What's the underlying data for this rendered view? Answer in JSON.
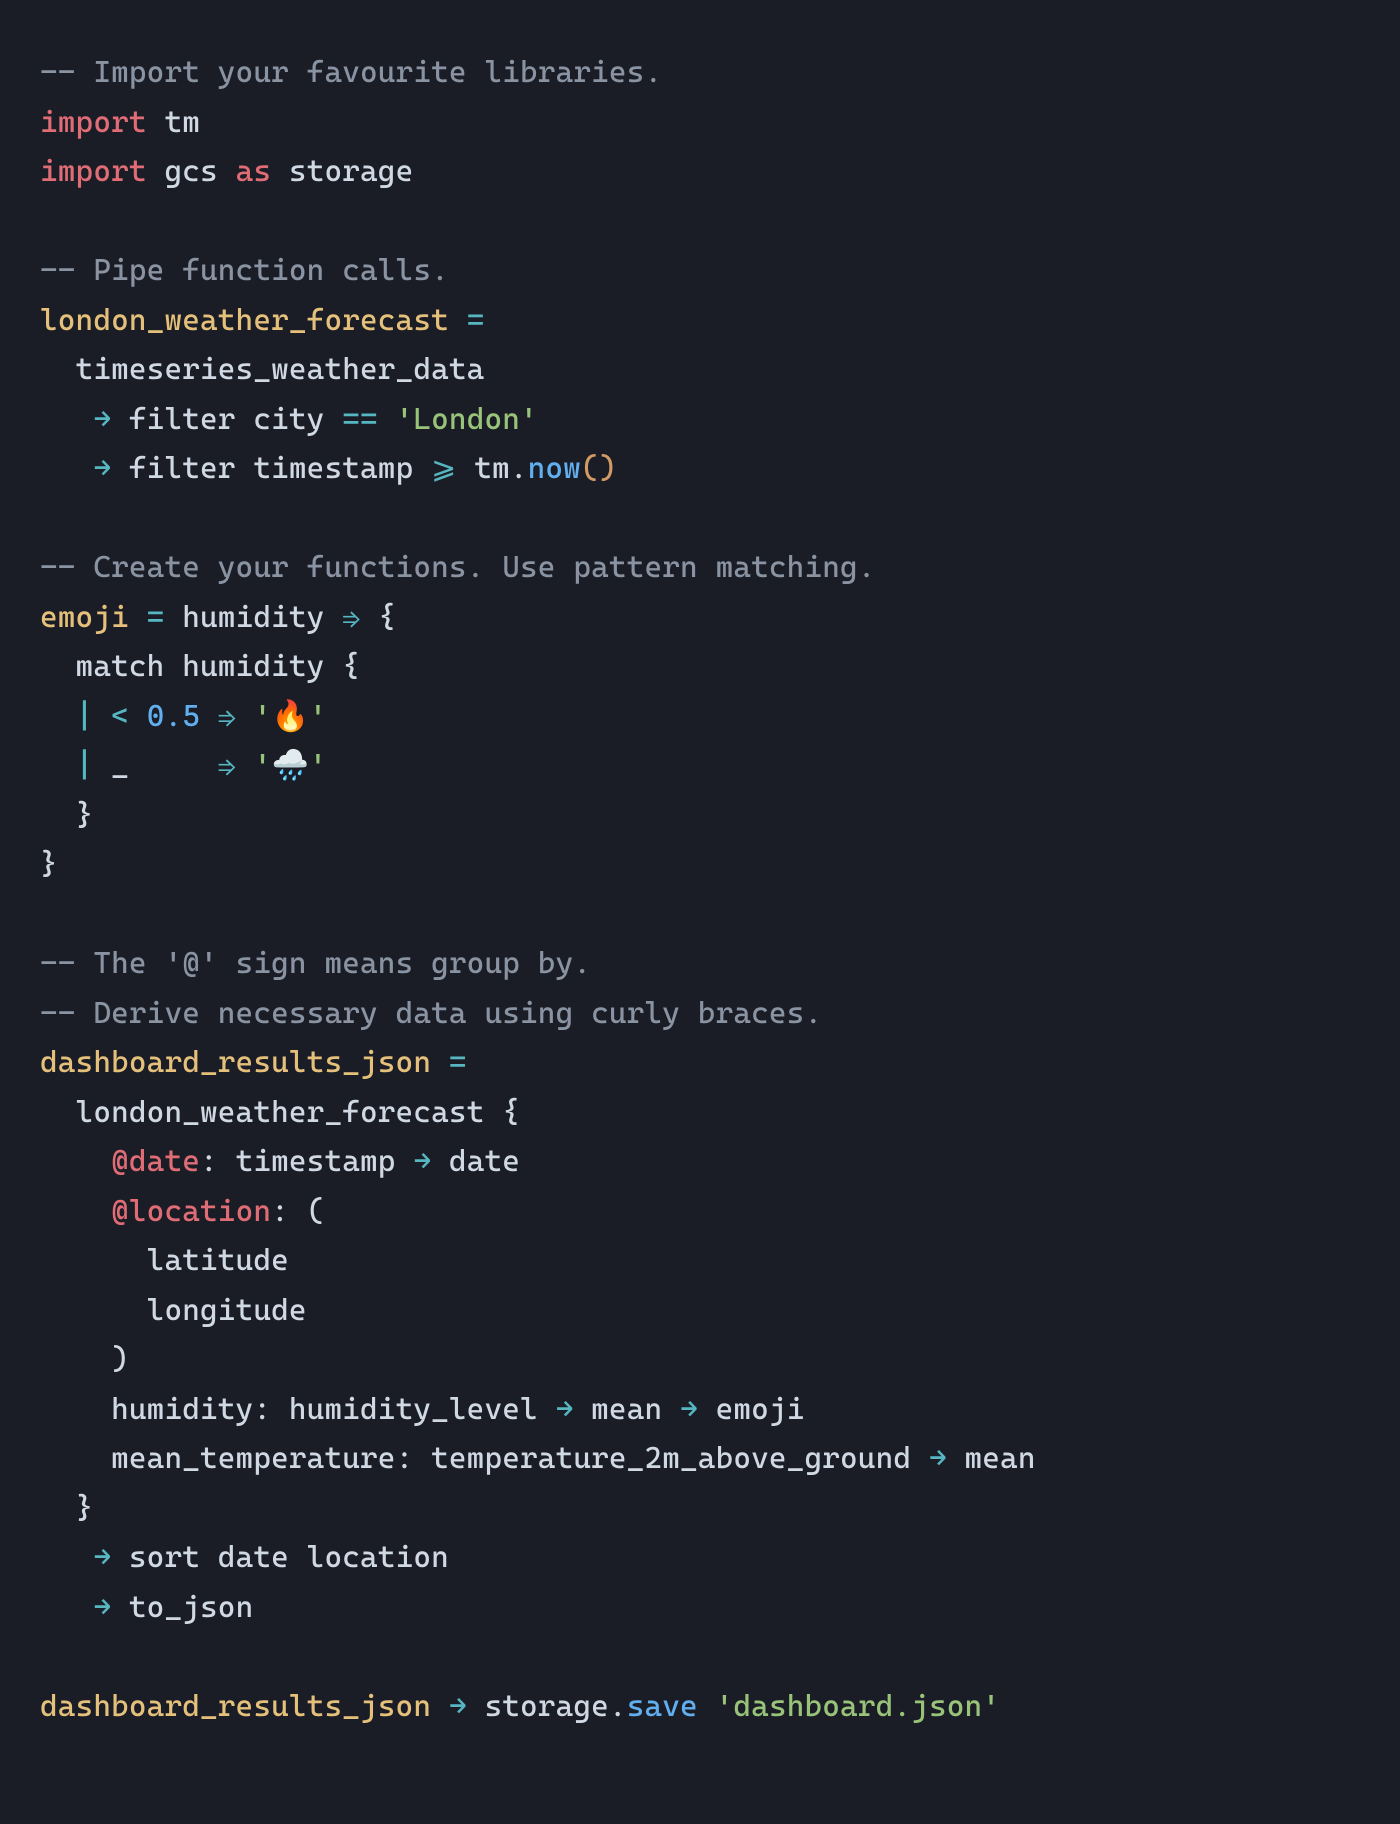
{
  "lines": [
    [
      {
        "cls": "c-comment",
        "t": "-- Import your favourite libraries."
      }
    ],
    [
      {
        "cls": "c-keyword",
        "t": "import"
      },
      {
        "cls": "c-ident",
        "t": " "
      },
      {
        "cls": "c-module",
        "t": "tm"
      }
    ],
    [
      {
        "cls": "c-keyword",
        "t": "import"
      },
      {
        "cls": "c-ident",
        "t": " "
      },
      {
        "cls": "c-module",
        "t": "gcs"
      },
      {
        "cls": "c-ident",
        "t": " "
      },
      {
        "cls": "c-keyword",
        "t": "as"
      },
      {
        "cls": "c-ident",
        "t": " "
      },
      {
        "cls": "c-module",
        "t": "storage"
      }
    ],
    [],
    [
      {
        "cls": "c-comment",
        "t": "-- Pipe function calls."
      }
    ],
    [
      {
        "cls": "c-decl",
        "t": "london_weather_forecast"
      },
      {
        "cls": "c-ident",
        "t": " "
      },
      {
        "cls": "c-op",
        "t": "="
      }
    ],
    [
      {
        "cls": "c-ident",
        "t": "  timeseries_weather_data"
      }
    ],
    [
      {
        "cls": "c-ident",
        "t": "   "
      },
      {
        "cls": "c-arrow",
        "t": "→"
      },
      {
        "cls": "c-ident",
        "t": " filter city "
      },
      {
        "cls": "c-op",
        "t": "=="
      },
      {
        "cls": "c-ident",
        "t": " "
      },
      {
        "cls": "c-string",
        "t": "'London'"
      }
    ],
    [
      {
        "cls": "c-ident",
        "t": "   "
      },
      {
        "cls": "c-arrow",
        "t": "→"
      },
      {
        "cls": "c-ident",
        "t": " filter timestamp "
      },
      {
        "cls": "c-op",
        "t": "⩾"
      },
      {
        "cls": "c-ident",
        "t": " tm"
      },
      {
        "cls": "c-punct",
        "t": "."
      },
      {
        "cls": "c-func",
        "t": "now"
      },
      {
        "cls": "c-paren",
        "t": "()"
      }
    ],
    [],
    [
      {
        "cls": "c-comment",
        "t": "-- Create your functions. Use pattern matching."
      }
    ],
    [
      {
        "cls": "c-decl",
        "t": "emoji"
      },
      {
        "cls": "c-ident",
        "t": " "
      },
      {
        "cls": "c-op",
        "t": "="
      },
      {
        "cls": "c-ident",
        "t": " humidity "
      },
      {
        "cls": "c-arrow",
        "t": "⇒"
      },
      {
        "cls": "c-ident",
        "t": " "
      },
      {
        "cls": "c-punct",
        "t": "{"
      }
    ],
    [
      {
        "cls": "c-ident",
        "t": "  match humidity "
      },
      {
        "cls": "c-punct",
        "t": "{"
      }
    ],
    [
      {
        "cls": "c-ident",
        "t": "  "
      },
      {
        "cls": "c-op",
        "t": "|"
      },
      {
        "cls": "c-ident",
        "t": " "
      },
      {
        "cls": "c-op",
        "t": "<"
      },
      {
        "cls": "c-ident",
        "t": " "
      },
      {
        "cls": "c-number",
        "t": "0.5"
      },
      {
        "cls": "c-ident",
        "t": " "
      },
      {
        "cls": "c-arrow",
        "t": "⇒"
      },
      {
        "cls": "c-ident",
        "t": " "
      },
      {
        "cls": "c-string",
        "t": "'"
      },
      {
        "cls": "c-emoji",
        "t": "🔥"
      },
      {
        "cls": "c-string",
        "t": "'"
      }
    ],
    [
      {
        "cls": "c-ident",
        "t": "  "
      },
      {
        "cls": "c-op",
        "t": "|"
      },
      {
        "cls": "c-ident",
        "t": " _     "
      },
      {
        "cls": "c-arrow",
        "t": "⇒"
      },
      {
        "cls": "c-ident",
        "t": " "
      },
      {
        "cls": "c-string",
        "t": "'"
      },
      {
        "cls": "c-emoji",
        "t": "🌧️"
      },
      {
        "cls": "c-string",
        "t": "'"
      }
    ],
    [
      {
        "cls": "c-ident",
        "t": "  "
      },
      {
        "cls": "c-punct",
        "t": "}"
      }
    ],
    [
      {
        "cls": "c-punct",
        "t": "}"
      }
    ],
    [],
    [
      {
        "cls": "c-comment",
        "t": "-- The '@' sign means group by."
      }
    ],
    [
      {
        "cls": "c-comment",
        "t": "-- Derive necessary data using curly braces."
      }
    ],
    [
      {
        "cls": "c-decl",
        "t": "dashboard_results_json"
      },
      {
        "cls": "c-ident",
        "t": " "
      },
      {
        "cls": "c-op",
        "t": "="
      }
    ],
    [
      {
        "cls": "c-ident",
        "t": "  london_weather_forecast "
      },
      {
        "cls": "c-punct",
        "t": "{"
      }
    ],
    [
      {
        "cls": "c-ident",
        "t": "    "
      },
      {
        "cls": "c-at",
        "t": "@date"
      },
      {
        "cls": "c-punct",
        "t": ":"
      },
      {
        "cls": "c-ident",
        "t": " timestamp "
      },
      {
        "cls": "c-arrow",
        "t": "→"
      },
      {
        "cls": "c-ident",
        "t": " date"
      }
    ],
    [
      {
        "cls": "c-ident",
        "t": "    "
      },
      {
        "cls": "c-at",
        "t": "@location"
      },
      {
        "cls": "c-punct",
        "t": ":"
      },
      {
        "cls": "c-ident",
        "t": " "
      },
      {
        "cls": "c-punct",
        "t": "("
      }
    ],
    [
      {
        "cls": "c-ident",
        "t": "      latitude"
      }
    ],
    [
      {
        "cls": "c-ident",
        "t": "      longitude"
      }
    ],
    [
      {
        "cls": "c-ident",
        "t": "    "
      },
      {
        "cls": "c-punct",
        "t": ")"
      }
    ],
    [
      {
        "cls": "c-ident",
        "t": "    humidity"
      },
      {
        "cls": "c-punct",
        "t": ":"
      },
      {
        "cls": "c-ident",
        "t": " humidity_level "
      },
      {
        "cls": "c-arrow",
        "t": "→"
      },
      {
        "cls": "c-ident",
        "t": " mean "
      },
      {
        "cls": "c-arrow",
        "t": "→"
      },
      {
        "cls": "c-ident",
        "t": " emoji"
      }
    ],
    [
      {
        "cls": "c-ident",
        "t": "    mean_temperature"
      },
      {
        "cls": "c-punct",
        "t": ":"
      },
      {
        "cls": "c-ident",
        "t": " temperature_2m_above_ground "
      },
      {
        "cls": "c-arrow",
        "t": "→"
      },
      {
        "cls": "c-ident",
        "t": " mean"
      }
    ],
    [
      {
        "cls": "c-ident",
        "t": "  "
      },
      {
        "cls": "c-punct",
        "t": "}"
      }
    ],
    [
      {
        "cls": "c-ident",
        "t": "   "
      },
      {
        "cls": "c-arrow",
        "t": "→"
      },
      {
        "cls": "c-ident",
        "t": " sort date location"
      }
    ],
    [
      {
        "cls": "c-ident",
        "t": "   "
      },
      {
        "cls": "c-arrow",
        "t": "→"
      },
      {
        "cls": "c-ident",
        "t": " to_json"
      }
    ],
    [],
    [
      {
        "cls": "c-decl",
        "t": "dashboard_results_json"
      },
      {
        "cls": "c-ident",
        "t": " "
      },
      {
        "cls": "c-arrow",
        "t": "→"
      },
      {
        "cls": "c-ident",
        "t": " storage"
      },
      {
        "cls": "c-punct",
        "t": "."
      },
      {
        "cls": "c-func",
        "t": "save"
      },
      {
        "cls": "c-ident",
        "t": " "
      },
      {
        "cls": "c-string",
        "t": "'dashboard.json'"
      }
    ]
  ]
}
